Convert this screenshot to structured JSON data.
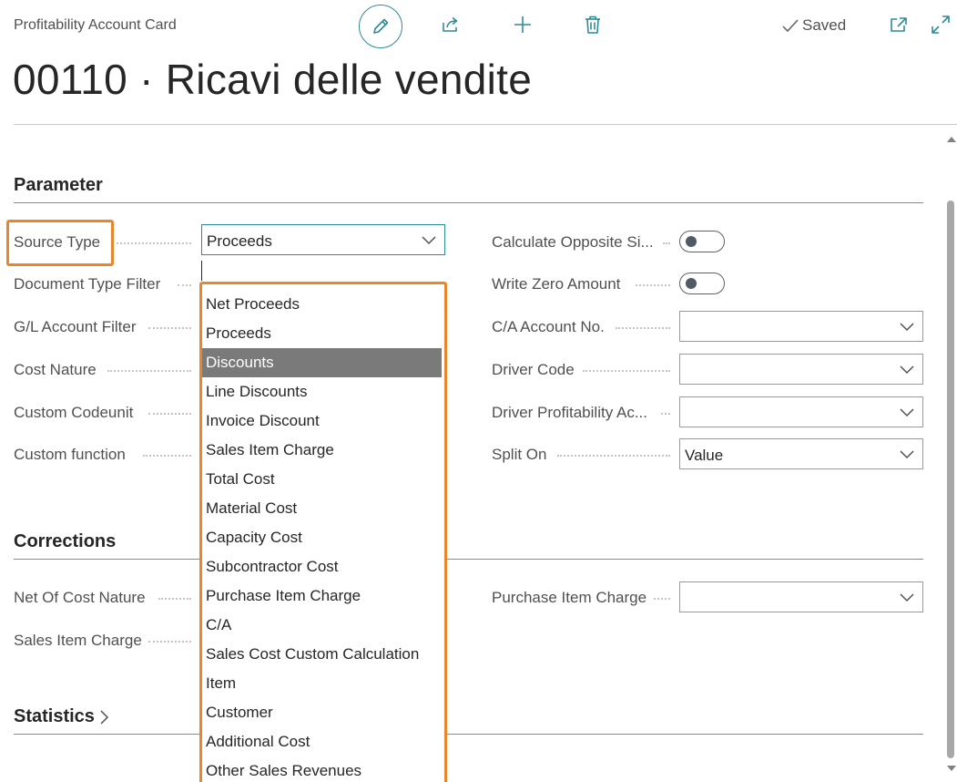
{
  "header": {
    "breadcrumb": "Profitability Account Card",
    "saved_label": "Saved",
    "page_title": "00110 · Ricavi delle vendite",
    "icons": [
      "edit-icon",
      "share-icon",
      "new-icon",
      "delete-icon",
      "checkmark-icon",
      "popout-icon",
      "expand-icon"
    ]
  },
  "sections": {
    "parameter": {
      "title": "Parameter",
      "left_fields": {
        "source_type": {
          "label": "Source Type",
          "value": "Proceeds"
        },
        "document_type_filter": {
          "label": "Document Type Filter"
        },
        "gl_account_filter": {
          "label": "G/L Account Filter"
        },
        "cost_nature": {
          "label": "Cost Nature"
        },
        "custom_codeunit": {
          "label": "Custom Codeunit"
        },
        "custom_function": {
          "label": "Custom function"
        }
      },
      "right_fields": {
        "calculate_opposite": {
          "label": "Calculate Opposite Si...",
          "on": false
        },
        "write_zero_amount": {
          "label": "Write Zero Amount",
          "on": false
        },
        "ca_account_no": {
          "label": "C/A Account No.",
          "value": ""
        },
        "driver_code": {
          "label": "Driver Code",
          "value": ""
        },
        "driver_profitability": {
          "label": "Driver Profitability Ac...",
          "value": ""
        },
        "split_on": {
          "label": "Split On",
          "value": "Value"
        }
      }
    },
    "corrections": {
      "title": "Corrections",
      "net_of_cost_nature": {
        "label": "Net Of Cost Nature"
      },
      "sales_item_charge": {
        "label": "Sales Item Charge"
      },
      "purchase_item_charge": {
        "label": "Purchase Item Charge",
        "value": ""
      }
    },
    "statistics": {
      "title": "Statistics"
    }
  },
  "source_type_dropdown": {
    "selected_index": 2,
    "options": [
      "Net Proceeds",
      "Proceeds",
      "Discounts",
      "Line Discounts",
      "Invoice Discount",
      "Sales Item Charge",
      "Total Cost",
      "Material Cost",
      "Capacity Cost",
      "Subcontractor Cost",
      "Purchase Item Charge",
      "C/A",
      "Sales Cost Custom Calculation",
      "Item",
      "Customer",
      "Additional Cost",
      "Other Sales Revenues"
    ]
  },
  "colors": {
    "accent": "#2e8a94",
    "highlight": "#e8862e",
    "selected_option_bg": "#7a7a7a"
  }
}
